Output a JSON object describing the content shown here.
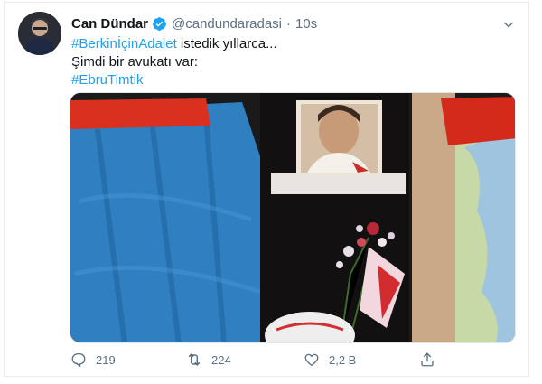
{
  "author": {
    "name": "Can Dündar",
    "handle": "@candundaradasi",
    "time": "10s"
  },
  "text": {
    "hashtag1": "#BerkinİçinAdalet",
    "line1_rest": "istedik yıllarca...",
    "line2": "Şimdi bir avukatı var:",
    "hashtag2": "#EbruTimtik"
  },
  "actions": {
    "reply_count": "219",
    "retweet_count": "224",
    "like_count": "2,2 B"
  },
  "icons": {
    "verified": "verified-badge-icon",
    "caret": "chevron-down-icon",
    "reply": "reply-icon",
    "retweet": "retweet-icon",
    "like": "heart-icon",
    "share": "share-icon"
  },
  "colors": {
    "link": "#1da1f2",
    "secondary_text": "#5b7083",
    "border": "#e6ecf0"
  }
}
